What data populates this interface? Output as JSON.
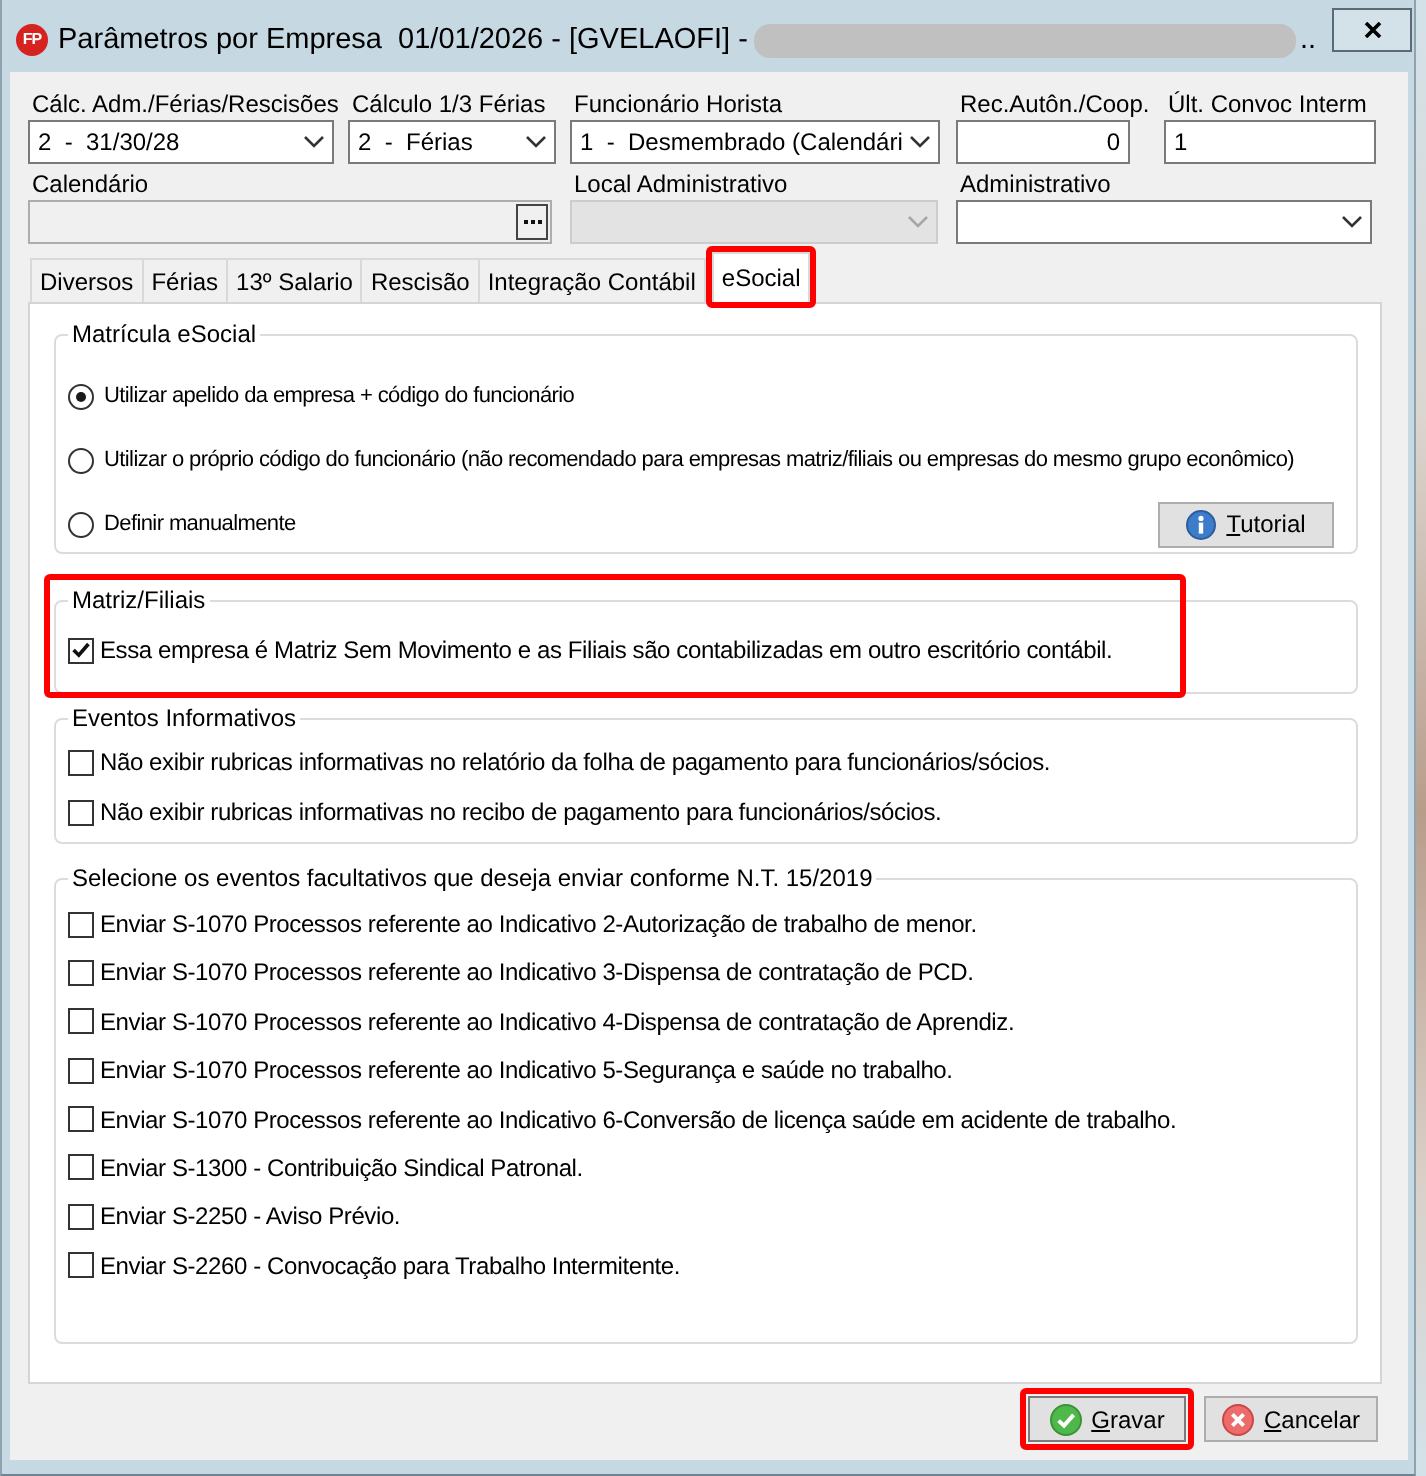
{
  "window": {
    "icon_label": "FP",
    "title": "Parâmetros por Empresa  01/01/2026 - [GVELAOFI] -",
    "redacted": true,
    "title_end": ".."
  },
  "field_rows": [
    {
      "fields": [
        {
          "label": "Cálc. Adm./Férias/Rescisões",
          "kind": "dropdown",
          "value": "2  -  31/30/28",
          "disabled": false
        },
        {
          "label": "Cálculo 1/3 Férias",
          "kind": "dropdown",
          "value": "2  -  Férias",
          "disabled": false
        },
        {
          "label": "Funcionário Horista",
          "kind": "dropdown",
          "value": "1  -  Desmembrado (Calendári",
          "disabled": false
        },
        {
          "label": "Rec.Autôn./Coop.",
          "kind": "number",
          "value": "0",
          "disabled": false
        },
        {
          "label": "Últ. Convoc Interm",
          "kind": "text",
          "value": "1",
          "disabled": false
        }
      ]
    },
    {
      "fields": [
        {
          "label": "Calendário",
          "kind": "lookup",
          "disabled": true
        },
        {
          "label": "Local Administrativo",
          "kind": "dropdown",
          "disabled": true
        },
        {
          "label": "Administrativo",
          "kind": "dropdown",
          "disabled": false
        }
      ]
    }
  ],
  "tabs": [
    {
      "label": "Diversos",
      "selected": false,
      "highlighted": false
    },
    {
      "label": "Férias",
      "selected": false,
      "highlighted": false
    },
    {
      "label": "13º Salario",
      "selected": false,
      "highlighted": false
    },
    {
      "label": "Rescisão",
      "selected": false,
      "highlighted": false
    },
    {
      "label": "Integração Contábil",
      "selected": false,
      "highlighted": false
    },
    {
      "label": "eSocial",
      "selected": true,
      "highlighted": true
    }
  ],
  "groups": [
    {
      "title": "Matrícula eSocial",
      "highlighted": false,
      "items": [
        {
          "kind": "radio",
          "label": "Utilizar apelido da empresa + código do funcionário",
          "selected": true
        },
        {
          "kind": "radio",
          "label": "Utilizar o próprio código do funcionário (não recomendado para empresas matriz/filiais ou empresas do mesmo grupo econômico)",
          "selected": false
        },
        {
          "kind": "radio",
          "label": "Definir manualmente",
          "selected": false
        }
      ],
      "button": {
        "label": "Tutorial",
        "shortcut_underlined": true
      }
    },
    {
      "title": "Matriz/Filiais",
      "highlighted": true,
      "items": [
        {
          "kind": "checkbox",
          "label": "Essa empresa é Matriz Sem Movimento e as Filiais são contabilizadas em outro escritório contábil.",
          "checked": true
        }
      ]
    },
    {
      "title": "Eventos Informativos",
      "highlighted": false,
      "items": [
        {
          "kind": "checkbox",
          "label": "Não exibir rubricas informativas no relatório da folha de pagamento para funcionários/sócios.",
          "checked": false
        },
        {
          "kind": "checkbox",
          "label": "Não exibir rubricas informativas no recibo de pagamento para funcionários/sócios.",
          "checked": false
        }
      ]
    },
    {
      "title": "Selecione os eventos facultativos que deseja enviar conforme N.T. 15/2019",
      "highlighted": false,
      "items": [
        {
          "kind": "checkbox",
          "label": "Enviar S-1070 Processos referente ao Indicativo 2-Autorização de trabalho de menor.",
          "checked": false
        },
        {
          "kind": "checkbox",
          "label": "Enviar S-1070 Processos referente ao Indicativo 3-Dispensa de contratação de PCD.",
          "checked": false
        },
        {
          "kind": "checkbox",
          "label": "Enviar S-1070 Processos referente ao Indicativo 4-Dispensa de contratação de Aprendiz.",
          "checked": false
        },
        {
          "kind": "checkbox",
          "label": "Enviar S-1070 Processos referente ao Indicativo 5-Segurança e saúde no trabalho.",
          "checked": false
        },
        {
          "kind": "checkbox",
          "label": "Enviar S-1070 Processos referente ao Indicativo 6-Conversão de licença saúde em acidente de trabalho.",
          "checked": false
        },
        {
          "kind": "checkbox",
          "label": "Enviar S-1300 - Contribuição Sindical Patronal.",
          "checked": false
        },
        {
          "kind": "checkbox",
          "label": "Enviar S-2250 - Aviso Prévio.",
          "checked": false
        },
        {
          "kind": "checkbox",
          "label": "Enviar S-2260 - Convocação para Trabalho Intermitente.",
          "checked": false
        }
      ]
    }
  ],
  "buttons": [
    {
      "kind": "save",
      "label": "Gravar",
      "shortcut_underlined": true,
      "highlighted": true
    },
    {
      "kind": "cancel",
      "label": "Cancelar",
      "shortcut_underlined": true,
      "highlighted": false
    }
  ]
}
